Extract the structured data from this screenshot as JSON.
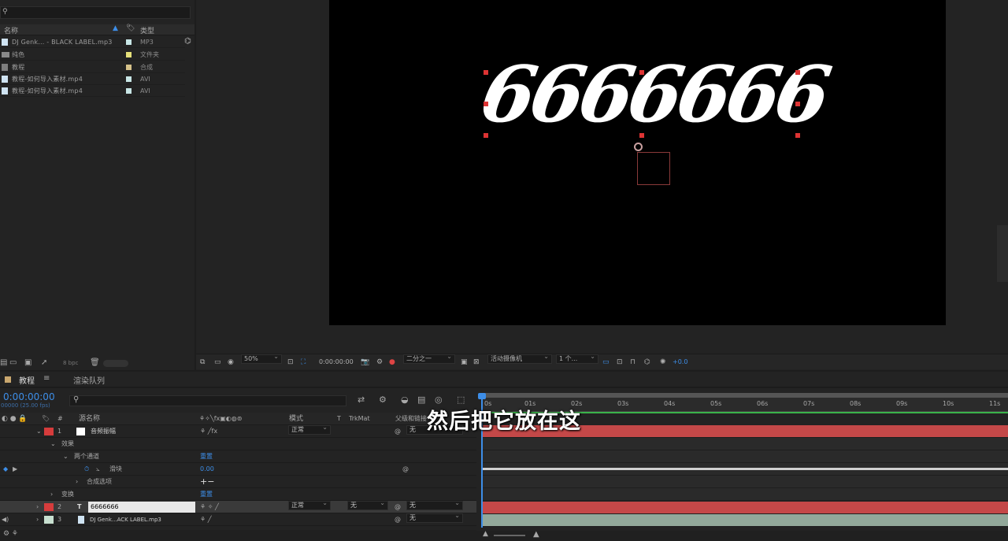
{
  "project": {
    "columns": {
      "name": "名称",
      "type": "类型"
    },
    "items": [
      {
        "name": "DJ Genk... - BLACK LABEL.mp3",
        "type": "MP3",
        "color": "#c8e6e6",
        "icon": "audio-file-icon"
      },
      {
        "name": "纯色",
        "type": "文件夹",
        "color": "#e6e07a",
        "icon": "folder-icon"
      },
      {
        "name": "教程",
        "type": "合成",
        "color": "#d6c28a",
        "icon": "composition-icon"
      },
      {
        "name": "教程-如何导入素材.mp4",
        "type": "AVI",
        "color": "#c8e6e6",
        "icon": "video-file-icon"
      },
      {
        "name": "教程-如何导入素材.mp4",
        "type": "AVI",
        "color": "#c8e6e6",
        "icon": "video-file-icon"
      }
    ],
    "bpc": "8 bpc"
  },
  "viewer": {
    "canvas_text": "6666666",
    "zoom": "50%",
    "timecode": "0:00:00:00",
    "resolution": "二分之一",
    "camera": "活动摄像机",
    "views": "1 个...",
    "exposure": "+0.0"
  },
  "timeline": {
    "comp_tab": "教程",
    "render_tab": "渲染队列",
    "current_time": "0:00:00:00",
    "fps_note": "00000 (25.00 fps)",
    "columns": {
      "num": "#",
      "source": "源名称",
      "mode": "模式",
      "t": "T",
      "trkmat": "TrkMat",
      "parent": "父级和链接"
    },
    "ruler": [
      "0s",
      "01s",
      "02s",
      "03s",
      "04s",
      "05s",
      "06s",
      "07s",
      "08s",
      "09s",
      "10s",
      "11s"
    ],
    "layers": {
      "l1": {
        "num": "1",
        "name": "音频振幅",
        "mode": "正常",
        "parent": "无",
        "color": "#d63c3c"
      },
      "effects": "效果",
      "effect_name": "两个通道",
      "reset": "重置",
      "slider_label": "滑块",
      "slider_value": "0.00",
      "comp_options": "合成选项",
      "transform": "变换",
      "transform_reset": "重置",
      "l2": {
        "num": "2",
        "name": "6666666",
        "mode": "正常",
        "trkmat": "无",
        "parent": "无",
        "color": "#d63c3c"
      },
      "l3": {
        "num": "3",
        "name": "DJ Genk...ACK LABEL.mp3",
        "parent": "无",
        "color": "#c8e0d0"
      }
    }
  },
  "subtitle": "然后把它放在这"
}
